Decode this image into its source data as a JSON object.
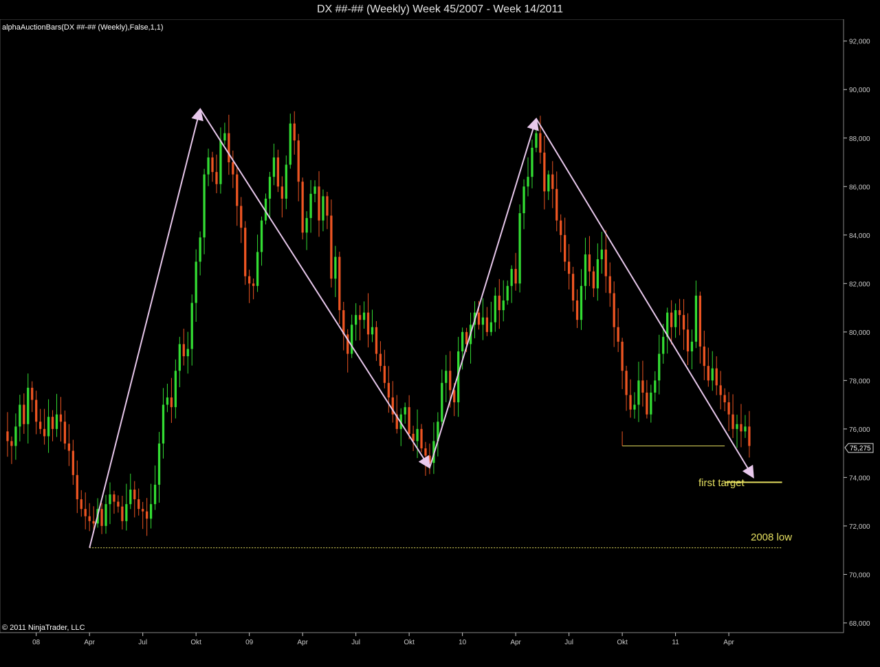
{
  "window": {
    "title": "DX ##-## (Weekly)  Week 45/2007 - Week 14/2011"
  },
  "indicator_label": "alphaAuctionBars(DX ##-## (Weekly),False,1,1)",
  "copyright": "© 2011 NinjaTrader, LLC",
  "price_marker": "75,275",
  "annotations": {
    "first_target": "first target",
    "low_2008": "2008 low"
  },
  "colors": {
    "background": "#000000",
    "up": "#33dd33",
    "down": "#ee5522",
    "arrow": "#e8c8ec",
    "annotation": "#e6e060",
    "axis": "#cccccc"
  },
  "chart_data": {
    "type": "candlestick",
    "title": "DX ##-## (Weekly)  Week 45/2007 - Week 14/2011",
    "x_ticks": [
      {
        "label": "08",
        "week": 8
      },
      {
        "label": "Apr",
        "week": 21
      },
      {
        "label": "Jul",
        "week": 34
      },
      {
        "label": "Okt",
        "week": 47
      },
      {
        "label": "09",
        "week": 60
      },
      {
        "label": "Apr",
        "week": 73
      },
      {
        "label": "Jul",
        "week": 86
      },
      {
        "label": "Okt",
        "week": 99
      },
      {
        "label": "10",
        "week": 112
      },
      {
        "label": "Apr",
        "week": 125
      },
      {
        "label": "Jul",
        "week": 138
      },
      {
        "label": "Okt",
        "week": 151
      },
      {
        "label": "11",
        "week": 164
      },
      {
        "label": "Apr",
        "week": 177
      }
    ],
    "y_ticks": [
      "68,000",
      "70,000",
      "72,000",
      "74,000",
      "76,000",
      "78,000",
      "80,000",
      "82,000",
      "84,000",
      "86,000",
      "88,000",
      "90,000",
      "92,000"
    ],
    "ylim": [
      67.6,
      92.9
    ],
    "xlim": [
      0,
      205
    ],
    "close_path": [
      [
        0,
        75.9
      ],
      [
        1,
        75.5
      ],
      [
        2,
        75.3
      ],
      [
        3,
        76.1
      ],
      [
        4,
        77.0
      ],
      [
        5,
        76.2
      ],
      [
        6,
        77.7
      ],
      [
        7,
        77.2
      ],
      [
        8,
        76.3
      ],
      [
        9,
        76.0
      ],
      [
        10,
        75.7
      ],
      [
        11,
        76.5
      ],
      [
        12,
        76.0
      ],
      [
        13,
        76.6
      ],
      [
        14,
        76.3
      ],
      [
        15,
        75.4
      ],
      [
        16,
        75.1
      ],
      [
        17,
        74.1
      ],
      [
        18,
        73.1
      ],
      [
        19,
        72.7
      ],
      [
        20,
        72.4
      ],
      [
        21,
        72.2
      ],
      [
        22,
        72.1
      ],
      [
        23,
        72.7
      ],
      [
        24,
        72.0
      ],
      [
        25,
        72.9
      ],
      [
        26,
        73.3
      ],
      [
        27,
        73.0
      ],
      [
        28,
        72.8
      ],
      [
        29,
        72.2
      ],
      [
        30,
        72.9
      ],
      [
        31,
        73.5
      ],
      [
        32,
        73.1
      ],
      [
        33,
        72.7
      ],
      [
        34,
        72.6
      ],
      [
        35,
        72.3
      ],
      [
        36,
        72.9
      ],
      [
        37,
        73.7
      ],
      [
        38,
        75.4
      ],
      [
        39,
        77.0
      ],
      [
        40,
        77.3
      ],
      [
        41,
        76.9
      ],
      [
        42,
        78.4
      ],
      [
        43,
        79.5
      ],
      [
        44,
        79.0
      ],
      [
        45,
        79.3
      ],
      [
        46,
        81.2
      ],
      [
        47,
        82.9
      ],
      [
        48,
        83.9
      ],
      [
        49,
        86.5
      ],
      [
        50,
        87.2
      ],
      [
        51,
        86.6
      ],
      [
        52,
        86.1
      ],
      [
        53,
        87.9
      ],
      [
        54,
        88.2
      ],
      [
        55,
        87.0
      ],
      [
        56,
        86.5
      ],
      [
        57,
        85.2
      ],
      [
        58,
        84.3
      ],
      [
        59,
        82.3
      ],
      [
        60,
        82.0
      ],
      [
        61,
        81.9
      ],
      [
        62,
        83.3
      ],
      [
        63,
        84.6
      ],
      [
        64,
        85.5
      ],
      [
        65,
        86.4
      ],
      [
        66,
        87.2
      ],
      [
        67,
        86.0
      ],
      [
        68,
        85.5
      ],
      [
        69,
        86.9
      ],
      [
        70,
        88.6
      ],
      [
        71,
        87.9
      ],
      [
        72,
        86.2
      ],
      [
        73,
        84.1
      ],
      [
        74,
        84.7
      ],
      [
        75,
        85.7
      ],
      [
        76,
        86.0
      ],
      [
        77,
        84.6
      ],
      [
        78,
        85.6
      ],
      [
        79,
        84.8
      ],
      [
        80,
        82.2
      ],
      [
        81,
        83.1
      ],
      [
        82,
        80.9
      ],
      [
        83,
        79.9
      ],
      [
        84,
        79.1
      ],
      [
        85,
        80.3
      ],
      [
        86,
        80.7
      ],
      [
        87,
        80.5
      ],
      [
        88,
        80.8
      ],
      [
        89,
        79.9
      ],
      [
        90,
        80.2
      ],
      [
        91,
        79.1
      ],
      [
        92,
        78.6
      ],
      [
        93,
        77.9
      ],
      [
        94,
        77.3
      ],
      [
        95,
        76.6
      ],
      [
        96,
        76.0
      ],
      [
        97,
        76.6
      ],
      [
        98,
        76.9
      ],
      [
        99,
        75.8
      ],
      [
        100,
        75.5
      ],
      [
        101,
        76.0
      ],
      [
        102,
        75.2
      ],
      [
        103,
        74.9
      ],
      [
        104,
        74.6
      ],
      [
        105,
        75.5
      ],
      [
        106,
        76.3
      ],
      [
        107,
        77.9
      ],
      [
        108,
        78.4
      ],
      [
        109,
        77.6
      ],
      [
        110,
        77.1
      ],
      [
        111,
        79.2
      ],
      [
        112,
        80.0
      ],
      [
        113,
        79.5
      ],
      [
        114,
        80.3
      ],
      [
        115,
        80.8
      ],
      [
        116,
        80.3
      ],
      [
        117,
        80.6
      ],
      [
        118,
        80.0
      ],
      [
        119,
        80.4
      ],
      [
        120,
        81.5
      ],
      [
        121,
        80.9
      ],
      [
        122,
        81.3
      ],
      [
        123,
        81.9
      ],
      [
        124,
        82.6
      ],
      [
        125,
        82.0
      ],
      [
        126,
        84.9
      ],
      [
        127,
        86.0
      ],
      [
        128,
        86.4
      ],
      [
        129,
        87.6
      ],
      [
        130,
        88.2
      ],
      [
        131,
        87.4
      ],
      [
        132,
        85.8
      ],
      [
        133,
        86.5
      ],
      [
        134,
        85.9
      ],
      [
        135,
        84.6
      ],
      [
        136,
        84.0
      ],
      [
        137,
        82.9
      ],
      [
        138,
        82.4
      ],
      [
        139,
        81.3
      ],
      [
        140,
        80.5
      ],
      [
        141,
        81.9
      ],
      [
        142,
        83.2
      ],
      [
        143,
        82.5
      ],
      [
        144,
        81.8
      ],
      [
        145,
        83.0
      ],
      [
        146,
        83.4
      ],
      [
        147,
        82.3
      ],
      [
        148,
        81.6
      ],
      [
        149,
        80.2
      ],
      [
        150,
        79.6
      ],
      [
        151,
        78.4
      ],
      [
        152,
        77.4
      ],
      [
        153,
        76.8
      ],
      [
        154,
        77.0
      ],
      [
        155,
        78.0
      ],
      [
        156,
        77.5
      ],
      [
        157,
        76.6
      ],
      [
        158,
        77.5
      ],
      [
        159,
        78.0
      ],
      [
        160,
        79.1
      ],
      [
        161,
        79.8
      ],
      [
        162,
        80.8
      ],
      [
        163,
        80.2
      ],
      [
        164,
        80.9
      ],
      [
        165,
        80.7
      ],
      [
        166,
        80.1
      ],
      [
        167,
        79.2
      ],
      [
        168,
        79.6
      ],
      [
        169,
        81.5
      ],
      [
        170,
        79.4
      ],
      [
        171,
        78.6
      ],
      [
        172,
        78.0
      ],
      [
        173,
        78.5
      ],
      [
        174,
        77.8
      ],
      [
        175,
        77.4
      ],
      [
        176,
        77.1
      ],
      [
        177,
        76.6
      ],
      [
        178,
        76.0
      ],
      [
        179,
        76.2
      ],
      [
        180,
        75.9
      ],
      [
        181,
        76.1
      ],
      [
        182,
        75.3
      ]
    ],
    "overlays": {
      "arrows": [
        {
          "from": [
            21,
            71.1
          ],
          "to": [
            48,
            89.2
          ]
        },
        {
          "from": [
            48,
            89.2
          ],
          "to": [
            104,
            74.4
          ]
        },
        {
          "from": [
            104,
            74.4
          ],
          "to": [
            130,
            88.8
          ]
        },
        {
          "from": [
            130,
            88.8
          ],
          "to": [
            183,
            74.0
          ]
        }
      ],
      "first_target": {
        "x": [
          176,
          190
        ],
        "y": 73.8
      },
      "low_2008": {
        "x": [
          21,
          190
        ],
        "y": 71.1
      },
      "support_line": {
        "x": [
          151,
          176
        ],
        "y": 75.3
      }
    }
  }
}
